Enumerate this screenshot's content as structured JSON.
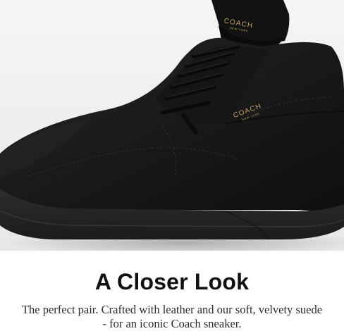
{
  "hero": {
    "brand_mark": "COACH",
    "brand_sub": "NEW YORK",
    "colors": {
      "suede": "#171717",
      "sole": "#262626",
      "background": "#efefef",
      "gold_logo": "#c9a45c"
    }
  },
  "content": {
    "title": "A Closer Look",
    "description": "The perfect pair. Crafted with leather and our soft, velvety suede - for an iconic Coach sneaker."
  }
}
